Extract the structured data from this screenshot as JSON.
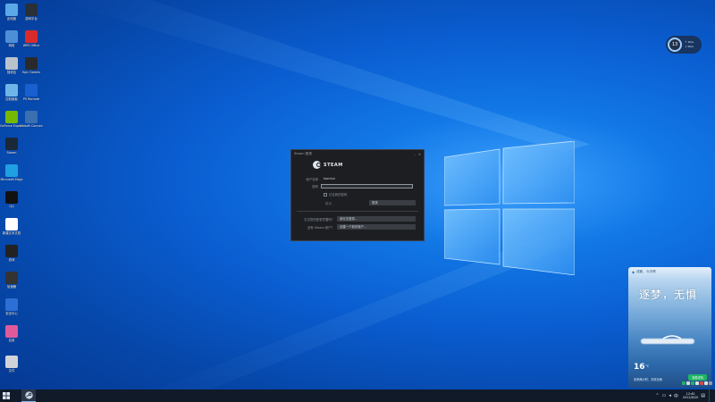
{
  "desktop": {
    "icons_col1": [
      {
        "label": "此电脑",
        "icon": "monitor-icon",
        "color": "#5aa9e6"
      },
      {
        "label": "网络",
        "icon": "network-icon",
        "color": "#4c8fd6"
      },
      {
        "label": "回收站",
        "icon": "recycle-bin-icon",
        "color": "#b8c4cc"
      },
      {
        "label": "控制面板",
        "icon": "control-panel-icon",
        "color": "#6fb5e8"
      },
      {
        "label": "GeForce Experience",
        "icon": "nvidia-icon",
        "color": "#76b900"
      },
      {
        "label": "Steam",
        "icon": "steam-icon",
        "color": "#1b2838"
      },
      {
        "label": "Microsoft Edge",
        "icon": "edge-icon",
        "color": "#1fa0e0"
      },
      {
        "label": "QQ",
        "icon": "qq-icon",
        "color": "#111111"
      },
      {
        "label": "新建文本文档",
        "icon": "text-doc-icon",
        "color": "#ffffff"
      },
      {
        "label": "游戏",
        "icon": "game-icon",
        "color": "#222222"
      },
      {
        "label": "加速器",
        "icon": "accelerator-icon",
        "color": "#333333"
      },
      {
        "label": "安全中心",
        "icon": "shield-icon",
        "color": "#2c6fd6"
      },
      {
        "label": "应用",
        "icon": "colorful-app-icon",
        "color": "#e05a9a"
      },
      {
        "label": "文件",
        "icon": "file-icon",
        "color": "#d0d4d8"
      }
    ],
    "icons_col2": [
      {
        "label": "游戏平台",
        "icon": "game-platform-icon",
        "color": "#2a2f38"
      },
      {
        "label": "WPS Office",
        "icon": "wps-icon",
        "color": "#d92b2b"
      },
      {
        "label": "Epic Games",
        "icon": "epic-icon",
        "color": "#2a2a2a"
      },
      {
        "label": "PS Remote",
        "icon": "playstation-icon",
        "color": "#1a5fcf"
      },
      {
        "label": "Ubisoft Connect",
        "icon": "ubisoft-icon",
        "color": "#3a6fb0"
      }
    ]
  },
  "steam_dialog": {
    "title": "Steam 登录",
    "brand": "STEAM",
    "account_label": "帐户名称",
    "account_value": "toonhui",
    "password_label": "密码",
    "password_value": "",
    "remember_label": "记住我的密码",
    "cancel_label": "取消",
    "login_label": "登录",
    "forgot_label": "忘记您的登录凭据吗？",
    "forgot_button": "我无法登录...",
    "no_account_label": "没有 Steam 帐户？",
    "create_button": "创建一个新的帐户..."
  },
  "weather_chip": {
    "temp": "13",
    "line1": "↑ 1K/s",
    "line2": "↓ 0K/s"
  },
  "weather_widget": {
    "header": "成都，今天晴",
    "headline": "逐梦，无惧",
    "temp": "16",
    "unit": "°C",
    "description": "未来两小时，天晴无雨",
    "button": "查看详情"
  },
  "taskbar": {
    "time": "12:40",
    "date": "2022/6/20",
    "apps": [
      {
        "name": "start",
        "icon": "windows-start-icon"
      },
      {
        "name": "steam",
        "icon": "steam-icon",
        "active": true
      }
    ],
    "tray_icons": [
      "chevron-up-icon",
      "network-icon",
      "volume-icon",
      "ime-icon",
      "notification-icon"
    ]
  },
  "colors": {
    "accent": "#0a5ccf",
    "taskbar": "#101a28",
    "steam_bg": "#1c1e22"
  }
}
